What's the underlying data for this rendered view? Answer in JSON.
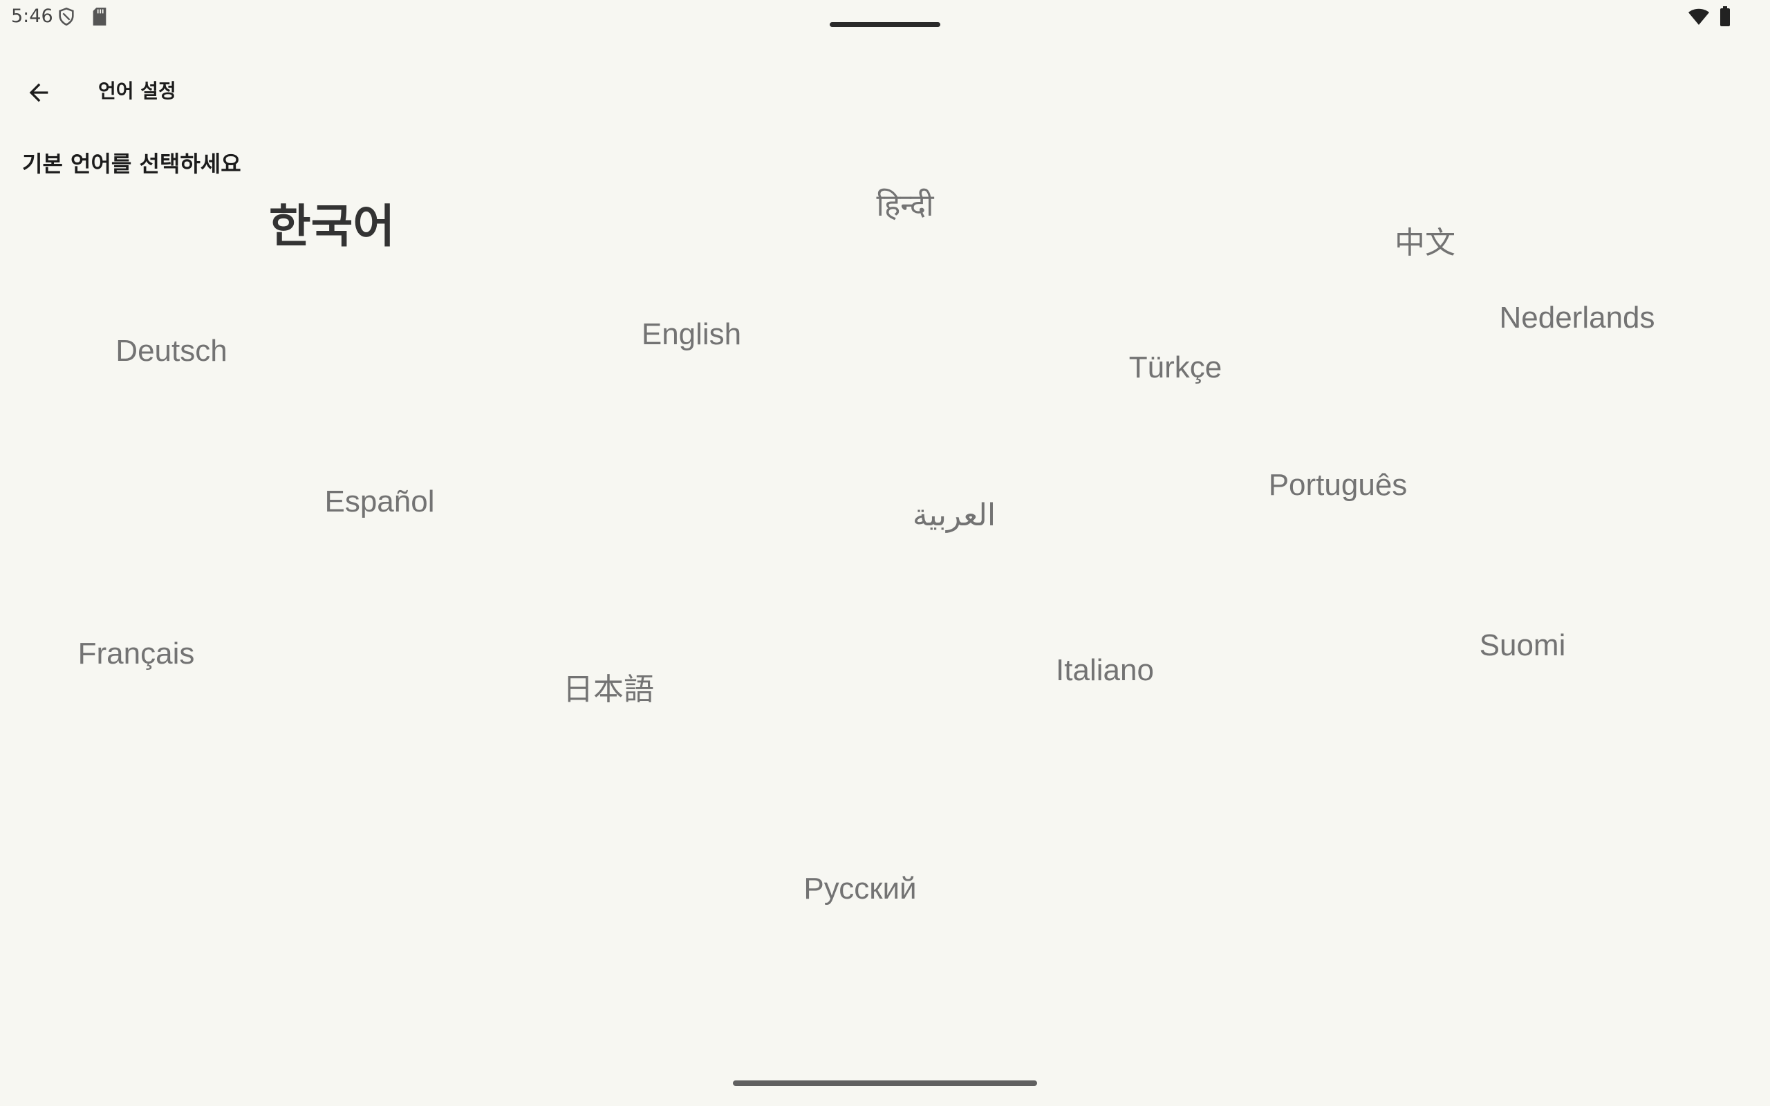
{
  "status_bar": {
    "time": "5:46",
    "icons": [
      "shield-icon",
      "sd-card-icon",
      "wifi-icon",
      "battery-icon"
    ]
  },
  "app_bar": {
    "title": "언어 설정",
    "back_icon": "arrow-back-icon"
  },
  "subtitle": "기본 언어를 선택하세요",
  "languages": [
    {
      "id": "ko",
      "label": "한국어",
      "selected": true
    },
    {
      "id": "hi",
      "label": "हिन्दी",
      "selected": false
    },
    {
      "id": "zh",
      "label": "中文",
      "selected": false
    },
    {
      "id": "nl",
      "label": "Nederlands",
      "selected": false
    },
    {
      "id": "de",
      "label": "Deutsch",
      "selected": false
    },
    {
      "id": "en",
      "label": "English",
      "selected": false
    },
    {
      "id": "tr",
      "label": "Türkçe",
      "selected": false
    },
    {
      "id": "es",
      "label": "Español",
      "selected": false
    },
    {
      "id": "ar",
      "label": "العربية",
      "selected": false
    },
    {
      "id": "pt",
      "label": "Português",
      "selected": false
    },
    {
      "id": "fr",
      "label": "Français",
      "selected": false
    },
    {
      "id": "ja",
      "label": "日本語",
      "selected": false
    },
    {
      "id": "it",
      "label": "Italiano",
      "selected": false
    },
    {
      "id": "fi",
      "label": "Suomi",
      "selected": false
    },
    {
      "id": "ru",
      "label": "Русский",
      "selected": false
    }
  ],
  "colors": {
    "background": "#f7f7f2",
    "language_text": "#737373",
    "selected_text": "#333333"
  }
}
